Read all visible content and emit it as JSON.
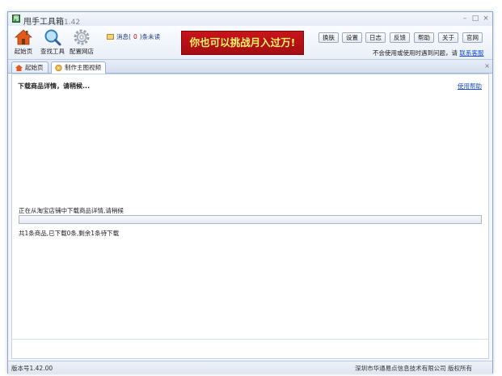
{
  "window": {
    "title": "甩手工具箱",
    "version": "1.42",
    "controls": {
      "minimize": "–",
      "maximize": "□",
      "close": "×"
    }
  },
  "toolbar": {
    "tools": [
      {
        "label": "起始页",
        "icon": "home-icon"
      },
      {
        "label": "查找工具",
        "icon": "search-icon"
      },
      {
        "label": "配置网店",
        "icon": "gear-icon"
      }
    ],
    "messages": {
      "prefix": "消息(",
      "count": "0",
      "suffix": ")条未读",
      "icon": "envelope-icon"
    },
    "banner": "你也可以挑战月入过万!",
    "buttons": [
      "换肤",
      "设置",
      "日志",
      "反馈",
      "帮助",
      "关于",
      "官网"
    ],
    "support": {
      "text": "不会使用或使用时遇到问题，请",
      "link": "联系客服"
    }
  },
  "tabs": [
    {
      "label": "起始页",
      "icon": "home-icon",
      "active": false
    },
    {
      "label": "制作主图视频",
      "icon": "video-icon",
      "active": true
    }
  ],
  "tab_close": "×",
  "content": {
    "heading": "下载商品详情，请稍候...",
    "help_link": "使用帮助",
    "status_text": "正在从淘宝店铺中下载商品详情,请稍候",
    "progress_percent": 0,
    "count_text": "共1条商品,已下载0条,剩余1条待下载"
  },
  "statusbar": {
    "version": "版本号1.42.00",
    "copyright": "深圳市华通易点信息技术有限公司  版权所有"
  },
  "colors": {
    "banner_bg": "#c8141a",
    "banner_text": "#fff36a",
    "link": "#1a4fd6",
    "progress_fill": "#3da52b"
  }
}
